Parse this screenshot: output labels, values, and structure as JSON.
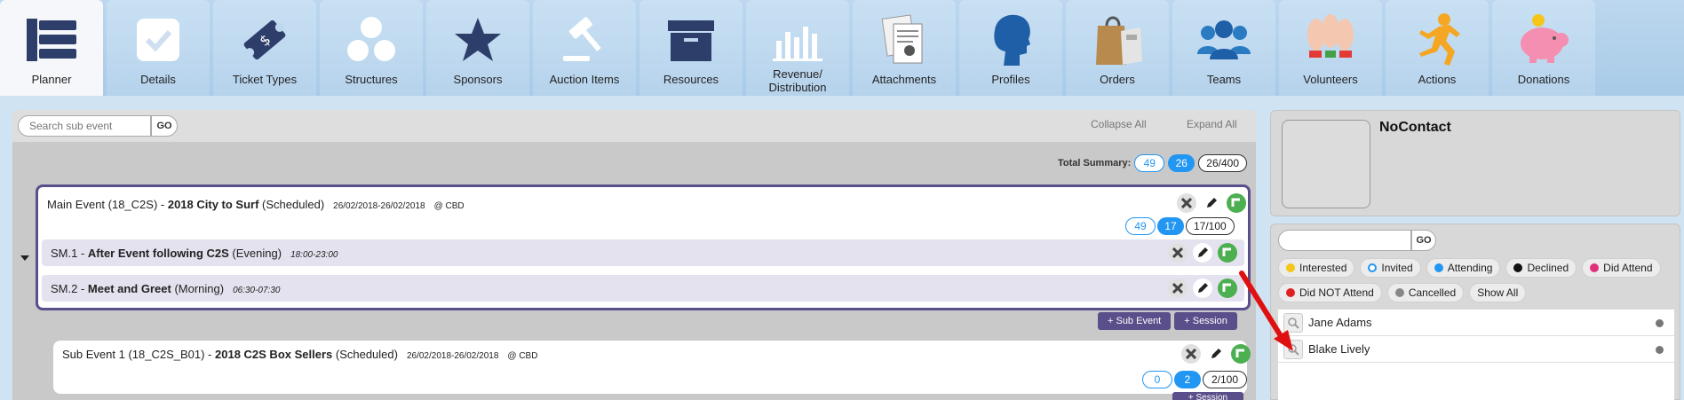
{
  "toolbar": {
    "items": [
      {
        "label": "Planner",
        "icon": "planner-icon",
        "active": true
      },
      {
        "label": "Details",
        "icon": "checkbox-icon"
      },
      {
        "label": "Ticket Types",
        "icon": "ticket-icon"
      },
      {
        "label": "Structures",
        "icon": "structures-icon"
      },
      {
        "label": "Sponsors",
        "icon": "star-icon"
      },
      {
        "label": "Auction Items",
        "icon": "gavel-icon"
      },
      {
        "label": "Resources",
        "icon": "archive-box-icon"
      },
      {
        "label": "Revenue/ Distribution",
        "icon": "bar-chart-icon"
      },
      {
        "label": "Attachments",
        "icon": "attachment-icon"
      },
      {
        "label": "Profiles",
        "icon": "profile-head-icon"
      },
      {
        "label": "Orders",
        "icon": "shopping-bag-icon"
      },
      {
        "label": "Teams",
        "icon": "team-icon"
      },
      {
        "label": "Volunteers",
        "icon": "raised-hands-icon"
      },
      {
        "label": "Actions",
        "icon": "running-man-icon"
      },
      {
        "label": "Donations",
        "icon": "piggy-bank-icon"
      }
    ]
  },
  "left": {
    "search_placeholder": "Search sub event",
    "go_label": "GO",
    "collapse_all": "Collapse All",
    "expand_all": "Expand All",
    "total_summary_label": "Total Summary:",
    "total": {
      "a": "49",
      "b": "26",
      "c": "26/400"
    },
    "main_event": {
      "prefix": "Main Event (18_C2S) - ",
      "name": "2018 City to Surf",
      "status": " (Scheduled)",
      "dates": "26/02/2018-26/02/2018",
      "location": "@ CBD",
      "pills": {
        "a": "49",
        "b": "17",
        "c": "17/100"
      }
    },
    "sessions": [
      {
        "prefix": "SM.1 - ",
        "name": "After Event following C2S",
        "period": " (Evening)",
        "time": "18:00-23:00"
      },
      {
        "prefix": "SM.2 - ",
        "name": "Meet and Greet",
        "period": " (Morning)",
        "time": "06:30-07:30"
      }
    ],
    "add_sub_event": "+ Sub Event",
    "add_session": "+ Session",
    "sub_event": {
      "prefix": "Sub Event 1 (18_C2S_B01) - ",
      "name": "2018 C2S Box Sellers",
      "status": " (Scheduled)",
      "dates": "26/02/2018-26/02/2018",
      "location": "@ CBD",
      "pills": {
        "a": "0",
        "b": "2",
        "c": "2/100"
      }
    }
  },
  "right": {
    "contact_name": "NoContact",
    "go_label": "GO",
    "filters": [
      {
        "label": "Interested",
        "color": "#f5c518"
      },
      {
        "label": "Invited",
        "color": "#2196f3",
        "hollow": true
      },
      {
        "label": "Attending",
        "color": "#2196f3"
      },
      {
        "label": "Declined",
        "color": "#111111"
      },
      {
        "label": "Did Attend",
        "color": "#e0307a"
      },
      {
        "label": "Did NOT Attend",
        "color": "#e02020"
      },
      {
        "label": "Cancelled",
        "color": "#888888"
      },
      {
        "label": "Show All"
      }
    ],
    "people": [
      {
        "name": "Jane Adams"
      },
      {
        "name": "Blake Lively"
      }
    ]
  }
}
